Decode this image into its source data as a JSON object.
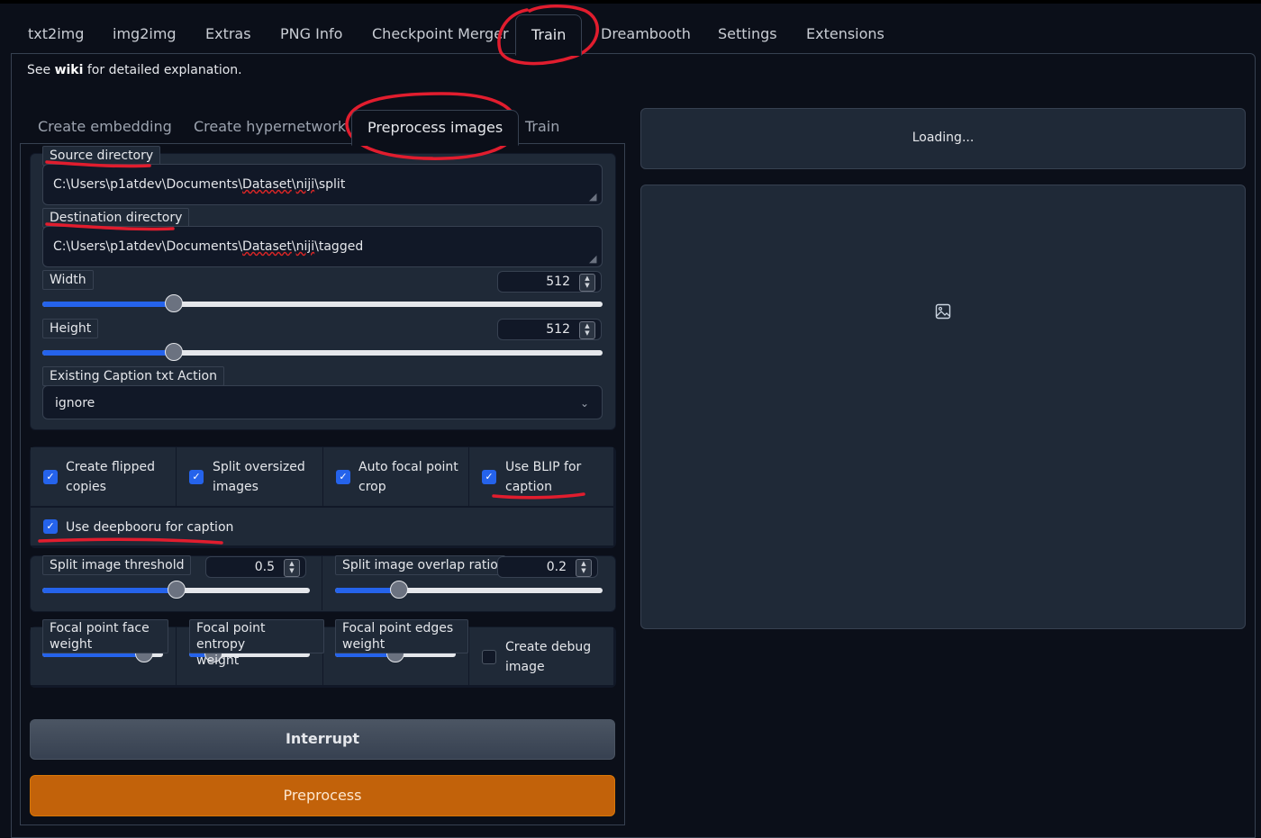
{
  "top_tabs": [
    "txt2img",
    "img2img",
    "Extras",
    "PNG Info",
    "Checkpoint Merger",
    "Train",
    "Dreambooth",
    "Settings",
    "Extensions"
  ],
  "active_top_tab": "Train",
  "wiki_line": {
    "prefix": "See ",
    "link": "wiki",
    "suffix": " for detailed explanation."
  },
  "sub_tabs": [
    "Create embedding",
    "Create hypernetwork",
    "Preprocess images",
    "Train"
  ],
  "active_sub_tab": "Preprocess images",
  "source_directory": {
    "label": "Source directory",
    "value_prefix": "C:\\Users\\p1atdev\\Documents\\",
    "value_dataset": "Dataset",
    "value_sep": "\\",
    "value_niji": "niji",
    "value_suffix": "\\split"
  },
  "destination_directory": {
    "label": "Destination directory",
    "value_prefix": "C:\\Users\\p1atdev\\Documents\\",
    "value_dataset": "Dataset",
    "value_sep": "\\",
    "value_niji": "niji",
    "value_suffix": "\\tagged"
  },
  "width": {
    "label": "Width",
    "value": "512",
    "fraction": 0.235
  },
  "height": {
    "label": "Height",
    "value": "512",
    "fraction": 0.235
  },
  "caption_action": {
    "label": "Existing Caption txt Action",
    "value": "ignore"
  },
  "checkboxes": [
    {
      "line1": "Create flipped",
      "line2": "copies",
      "checked": true
    },
    {
      "line1": "Split oversized",
      "line2": "images",
      "checked": true
    },
    {
      "line1": "Auto focal point",
      "line2": "crop",
      "checked": true
    },
    {
      "line1": "Use BLIP for",
      "line2": "caption",
      "checked": true
    }
  ],
  "deepbooru": {
    "label": "Use deepbooru for caption",
    "checked": true
  },
  "split_threshold": {
    "label": "Split image threshold",
    "value": "0.5",
    "fraction": 0.5
  },
  "overlap_ratio": {
    "label": "Split image overlap ratio",
    "value": "0.2",
    "fraction": 0.24
  },
  "focal_face": {
    "line1": "Focal point face",
    "line2": "weight",
    "fraction": 0.84
  },
  "focal_entropy": {
    "line1": "Focal point entropy",
    "line2": "weight",
    "fraction": 0.2
  },
  "focal_edges": {
    "line1": "Focal point edges",
    "line2": "weight",
    "fraction": 0.5
  },
  "debug_image": {
    "line1": "Create debug",
    "line2": "image",
    "checked": false
  },
  "buttons": {
    "interrupt": "Interrupt",
    "preprocess": "Preprocess"
  },
  "output": {
    "status": "Loading..."
  },
  "colors": {
    "accent": "#2563eb",
    "primary_button": "#c2620a",
    "annotation": "#e11d2e"
  }
}
